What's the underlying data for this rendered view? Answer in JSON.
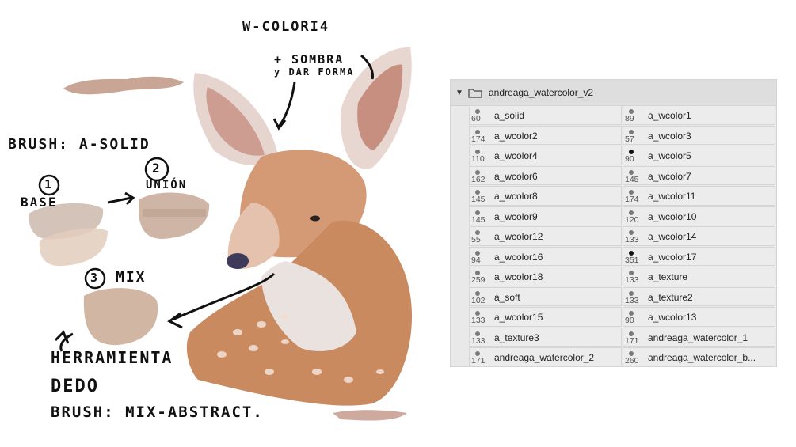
{
  "notes": {
    "top_label": "W-COLORI4",
    "sombra_line1": "+ SOMBRA",
    "sombra_line2": "y DAR FORMA",
    "brush_a_solid": "BRUSH: A-SOLID",
    "step1_num": "1",
    "step1_label": "BASE",
    "step2_num": "2",
    "step2_label": "UNIÓN",
    "step3_num": "3",
    "step3_label": "MIX",
    "tool_line1": "HERRAMIENTA",
    "tool_line2": "DEDO",
    "tool_line3": "BRUSH: MIX-ABSTRACT."
  },
  "colors": {
    "panel_bg": "#e9e9e9",
    "cell_bg": "#ececec",
    "fur": "#c98a5f",
    "ear_inner": "#b9705e",
    "swatch_base": "#cdb8ad",
    "swatch_mix": "#c9a994"
  },
  "brush_panel": {
    "folder_name": "andreaga_watercolor_v2",
    "brushes": [
      {
        "size": "60",
        "name": "a_solid",
        "dark": false
      },
      {
        "size": "89",
        "name": "a_wcolor1",
        "dark": false
      },
      {
        "size": "174",
        "name": "a_wcolor2",
        "dark": false
      },
      {
        "size": "57",
        "name": "a_wcolor3",
        "dark": false
      },
      {
        "size": "110",
        "name": "a_wcolor4",
        "dark": false
      },
      {
        "size": "90",
        "name": "a_wcolor5",
        "dark": true
      },
      {
        "size": "162",
        "name": "a_wcolor6",
        "dark": false
      },
      {
        "size": "145",
        "name": "a_wcolor7",
        "dark": false
      },
      {
        "size": "145",
        "name": "a_wcolor8",
        "dark": false
      },
      {
        "size": "174",
        "name": "a_wcolor11",
        "dark": false
      },
      {
        "size": "145",
        "name": "a_wcolor9",
        "dark": false
      },
      {
        "size": "120",
        "name": "a_wcolor10",
        "dark": false
      },
      {
        "size": "55",
        "name": "a_wcolor12",
        "dark": false
      },
      {
        "size": "133",
        "name": "a_wcolor14",
        "dark": false
      },
      {
        "size": "94",
        "name": "a_wcolor16",
        "dark": false
      },
      {
        "size": "351",
        "name": "a_wcolor17",
        "dark": true
      },
      {
        "size": "259",
        "name": "a_wcolor18",
        "dark": false
      },
      {
        "size": "133",
        "name": "a_texture",
        "dark": false
      },
      {
        "size": "102",
        "name": "a_soft",
        "dark": false
      },
      {
        "size": "133",
        "name": "a_texture2",
        "dark": false
      },
      {
        "size": "133",
        "name": "a_wcolor15",
        "dark": false
      },
      {
        "size": "90",
        "name": "a_wcolor13",
        "dark": false
      },
      {
        "size": "133",
        "name": "a_texture3",
        "dark": false
      },
      {
        "size": "171",
        "name": "andreaga_watercolor_1",
        "dark": false
      },
      {
        "size": "171",
        "name": "andreaga_watercolor_2",
        "dark": false
      },
      {
        "size": "260",
        "name": "andreaga_watercolor_b...",
        "dark": false
      }
    ]
  }
}
